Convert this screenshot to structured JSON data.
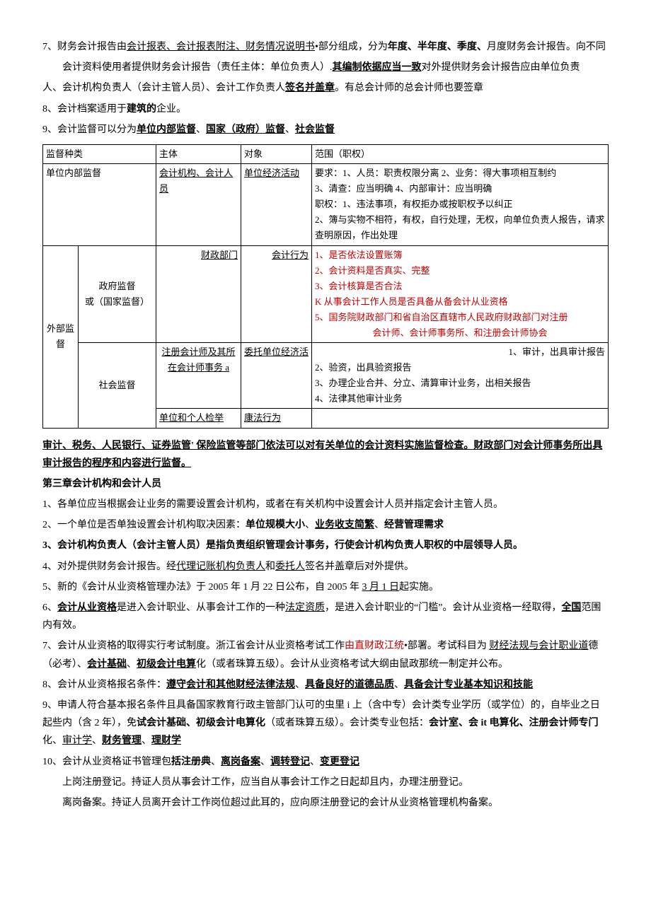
{
  "p7": {
    "lead": "7、财务会计报告由",
    "u1": "会计报表、会计报表附注、财务情况说明书",
    "mid1": "•部分组成，分为",
    "b1": "年度、半年度、季度、",
    "mid2": "月度财务会计报告。向不同",
    "line2a": "会计资料使用者提供财务会计报告（责任主体：单位负责人）.",
    "b2": "其编制依据应当一致",
    "line2b": "对外提供财务会计报告应由单位负责",
    "line3a": "人、会计机构负责人（会计主管人员）、会计工作负责人",
    "u2": "签名并盖章",
    "line3b": "。有总会计师的总会计师也要签章"
  },
  "p8": {
    "pre": "8、会计档案适用于",
    "b": "建筑的",
    "post": "企业。"
  },
  "p9": {
    "pre": "9、会计监督可以分为",
    "u1": "单位内部监督",
    "sep1": "、",
    "u2": "国家（政府）监督",
    "sep2": "、",
    "u3": "社会监督"
  },
  "table": {
    "header": {
      "c1": "监督种类",
      "c2": "主体",
      "c3": "对象",
      "c4": "范围（职权）"
    },
    "row_internal": {
      "c1": "单位内部监督",
      "c2": "会计机构、会计人员",
      "c3": "单位经济活动",
      "c4": "要求：1、人员：职责权限分离 2、业务：得大事项相互制约\n3、清查：应当明确 4、内部审计：应当明确\n职权：1、违法事项，有权拒办或按职权予以纠正\n2、簿与实物不相符，有权，自行处理，无权，向单位负责人报告，请求查明原因，作出处理"
    },
    "ext_label": "外部监督",
    "gov_label": "政府监督\n或（国家监督）",
    "gov_subject": "财政部门",
    "gov_object": "会计行为",
    "gov_scope": {
      "l1": "1、是否依法设置账簿",
      "l2": "2、会计资料是否真实、完整",
      "l3": "3、会计核算是否合法",
      "l4": "K 从事会计工作人员是否具备从备会计从业资格",
      "l5": "5、国务院财政部门和省自治区直辖市人民政府财政部门对注册",
      "l6": "会计师、会计师事务所、和注册会计师协会"
    },
    "soc_label": "社会监督",
    "soc_subject": "注册会计师及其所在会计师事务 a",
    "soc_object": "委托单位经济活",
    "soc_scope": "1、审计，出具审计报告\n2、验资，出具验资报告\n3、办理企业合并、分立、清算审计业务，出相关报告\n4、法律其他审计业务",
    "report_subject": "单位和个人检举",
    "report_object": "康法行为"
  },
  "under_table": {
    "line1": "审计、税务、人民银行、证券监管' 保险监管等部门依法可以对有关单位的会计资料实施监督检查。财政部门对会计师事务所出具审计报告的程序和内容进行监督。"
  },
  "chapter3": "第三章会计机构和会计人员",
  "c3p1": "1、各单位应当根据会让业务的需要设置会计机构，或者在有关机构中设置会计人员并指定会计主管人员。",
  "c3p2": {
    "pre": "2、一个单位是否单独设置会计机构取决因素：",
    "b1": "单位规模大小",
    "sep": "、",
    "u1": "业务收支简繁",
    "sep2": "、",
    "b2": "经营管理需求"
  },
  "c3p3": "3、会计机构负责人（会计主管人员）是指负责组织管理会计事务，行使会计机构负责人职权的中层领导人员。",
  "c3p4": {
    "pre": "4、对外提供财务会计报告。经",
    "u1": "代理记账机构负责人",
    "mid": "和",
    "u2": "委托人",
    "post": "签名并盖章后对外提供。"
  },
  "c3p5": {
    "pre": "5、新的《会计从业资格管理办法》于 2005 年 1 月 22 日公布，自 2005 年 ",
    "u": "3 月 1 日",
    "post": "起实施。"
  },
  "c3p6": {
    "pre": "6、",
    "u1": "会计从业资格",
    "mid1": "是进入会计职业、从事会计工作的一种",
    "u2": "法定资质",
    "mid2": "，是进入会计职业的“门槛”。会计从业资格一经取得，",
    "u3": "全国",
    "post": "范围内有效。"
  },
  "c3p7": {
    "pre": "7、会计从业资格的取得实行考试制度。浙江省会计从业资格考试工作",
    "red": "由直财政江统",
    "mid": "•部署。考试科目为 ",
    "u1": "财经法规与会计职业道",
    "mid2": "德（必考）、",
    "u2": "会计基础",
    "sep": "、",
    "u3": "初级会计电算",
    "post": "化（或者珠算五级）。会计从业资格考试大纲由鼠政那统一制定并公布。"
  },
  "c3p8": {
    "pre": "8、会计从业资格报名条件：",
    "u1": "遵守会计和其他财经法律法规",
    "sep": "、",
    "u2": "具备良好的道德品质",
    "sep2": "、",
    "u3": "具备会计专业基本知识和技能"
  },
  "c3p9": {
    "line1": "9、申请人符合基本报名条件且具备国家教育行政主管部门认可的虫里 i 上（含中专）会计类专业学历（或学位）的，自毕业之日起些内（含 2 年），免",
    "b1": "试会计基础、初级会计电算化",
    "mid": "（或者珠算五级）。会计类专业包括：",
    "b2": "会计室、会 it 电算化、注册会计师专门",
    "post1": "化、",
    "u1": "审计学",
    "sep": "、",
    "u2": "财务管理",
    "sep2": "、",
    "u3": "理财学"
  },
  "c3p10": {
    "pre": "10、会计从业资格证书管理包",
    "b1": "括注册典",
    "sep": "、",
    "u1": "离岗备案",
    "sep2": "、",
    "u2": "调转登记",
    "sep3": "、",
    "u3": "变更登记",
    "sub1": "上岗注册登记。持证人员从事会计工作，应当自从事会计工作之日起却且内，办理注册登记。",
    "sub2": "离岗备案。持证人员离开会计工作岗位超过此耳的，应向原注册登记的会计从业资格管理机构备案。"
  }
}
